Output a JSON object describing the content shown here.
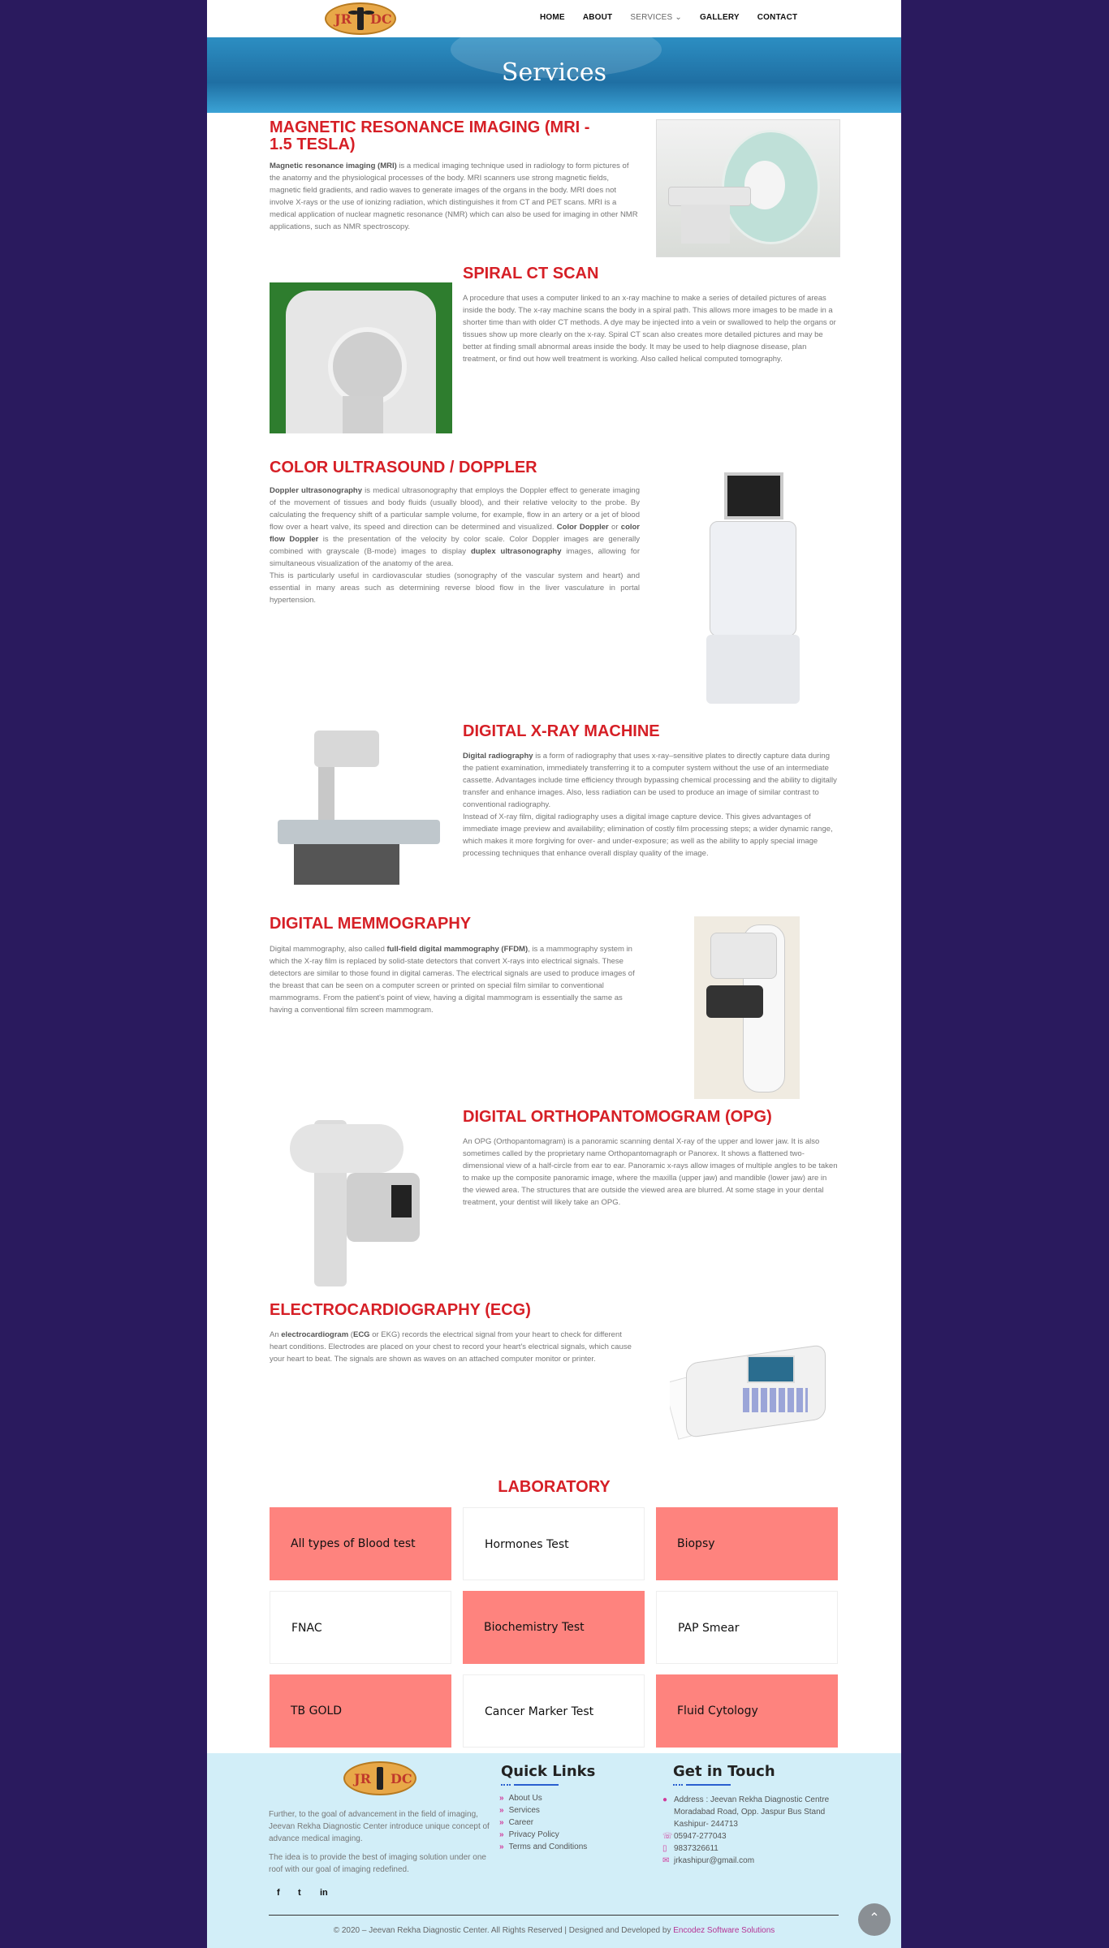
{
  "nav": {
    "logo_left": "JR",
    "logo_right": "DC",
    "items": [
      {
        "label": "HOME"
      },
      {
        "label": "ABOUT"
      },
      {
        "label": "SERVICES"
      },
      {
        "label": "GALLERY"
      },
      {
        "label": "CONTACT"
      }
    ],
    "services_chevron": "⌄"
  },
  "banner": {
    "title": "Services"
  },
  "sections": [
    {
      "title": "MAGNETIC RESONANCE IMAGING (MRI - 1.5 TESLA)",
      "lead": "Magnetic resonance imaging (MRI)",
      "text": " is a medical imaging technique used in radiology to form pictures of the anatomy and the physiological processes of the body. MRI scanners use strong magnetic fields, magnetic field gradients, and radio waves to generate images of the organs in the body. MRI does not involve X-rays or the use of ionizing radiation, which distinguishes it from CT and PET scans. MRI is a medical application of nuclear magnetic resonance (NMR) which can also be used for imaging in other NMR applications, such as NMR spectroscopy.",
      "image": "mri-scanner-image"
    },
    {
      "title": "SPIRAL CT SCAN",
      "text": "A procedure that uses a computer linked to an x-ray machine to make a series of detailed pictures of areas inside the body. The x-ray machine scans the body in a spiral path. This allows more images to be made in a shorter time than with older CT methods. A dye may be injected into a vein or swallowed to help the organs or tissues show up more clearly on the x-ray. Spiral CT scan also creates more detailed pictures and may be better at finding small abnormal areas inside the body. It may be used to help diagnose disease, plan treatment, or find out how well treatment is working. Also called helical computed tomography.",
      "image": "ct-scanner-image"
    },
    {
      "title": "COLOR ULTRASOUND / DOPPLER",
      "text_html_parts": [
        {
          "b": "Doppler ultrasonography"
        },
        {
          "t": " is medical ultrasonography that employs the Doppler effect to generate imaging of the movement of tissues and body fluids (usually blood), and their relative velocity to the probe. By calculating the frequency shift of a particular sample volume, for example, flow in an artery or a jet of blood flow over a heart valve, its speed and direction can be determined and visualized. "
        },
        {
          "b": "Color Doppler"
        },
        {
          "t": " or "
        },
        {
          "b": "color flow Doppler"
        },
        {
          "t": " is the presentation of the velocity by color scale. Color Doppler images are generally combined with grayscale (B-mode) images to display "
        },
        {
          "b": "duplex ultrasonography"
        },
        {
          "t": " images, allowing for simultaneous visualization of the anatomy of the area."
        }
      ],
      "text2": "This is particularly useful in cardiovascular studies (sonography of the vascular system and heart) and essential in many areas such as determining reverse blood flow in the liver vasculature in portal hypertension.",
      "image": "ultrasound-machine-image"
    },
    {
      "title": "DIGITAL X-RAY MACHINE",
      "lead": "Digital radiography",
      "text": " is a form of radiography that uses x-ray–sensitive plates to directly capture data during the patient examination, immediately transferring it to a computer system without the use of an intermediate cassette. Advantages include time efficiency through bypassing chemical processing and the ability to digitally transfer and enhance images. Also, less radiation can be used to produce an image of similar contrast to conventional radiography.",
      "text2": "Instead of X-ray film, digital radiography uses a digital image capture device. This gives advantages of immediate image preview and availability; elimination of costly film processing steps; a wider dynamic range, which makes it more forgiving for over- and under-exposure; as well as the ability to apply special image processing techniques that enhance overall display quality of the image.",
      "image": "xray-machine-image"
    },
    {
      "title": "DIGITAL MEMMOGRAPHY",
      "pre": "Digital mammography, also called ",
      "lead": "full-field digital mammography (FFDM)",
      "text": ", is a mammography system in which the X-ray film is replaced by solid-state detectors that convert X-rays into electrical signals. These detectors are similar to those found in digital cameras. The electrical signals are used to produce images of the breast that can be seen on a computer screen or printed on special film similar to conventional mammograms. From the patient's point of view, having a digital mammogram is essentially the same as having a conventional film screen mammogram.",
      "image": "mammography-machine-image"
    },
    {
      "title": "DIGITAL ORTHOPANTOMOGRAM (OPG)",
      "text": "An OPG (Orthopantomagram) is a panoramic scanning dental X-ray of the upper and lower jaw. It is also sometimes called by the proprietary name Orthopantomagraph or Panorex. It shows a flattened two-dimensional view of a half-circle from ear to ear. Panoramic x-rays allow images of multiple angles to be taken to make up the composite panoramic image, where the maxilla (upper jaw) and mandible (lower jaw) are in the viewed area. The structures that are outside the viewed area are blurred. At some stage in your dental treatment, your dentist will likely take an OPG.",
      "image": "opg-machine-image"
    },
    {
      "title": "ELECTROCARDIOGRAPHY (ECG)",
      "pre": "An ",
      "lead": "electrocardiogram",
      "mid": " (",
      "lead2": "ECG",
      "text": " or EKG) records the electrical signal from your heart to check for different heart conditions. Electrodes are placed on your chest to record your heart's electrical signals, which cause your heart to beat. The signals are shown as waves on an attached computer monitor or printer.",
      "image": "ecg-machine-image"
    }
  ],
  "laboratory": {
    "title": "LABORATORY",
    "items": [
      "All types of Blood test",
      "Hormones Test",
      "Biopsy",
      "FNAC",
      "Biochemistry Test",
      "PAP Smear",
      "TB GOLD",
      "Cancer Marker Test",
      "Fluid Cytology"
    ],
    "highlight_color": "#fe837e"
  },
  "footer": {
    "about1": "Further, to the goal of advancement in the field of imaging, Jeevan Rekha Diagnostic Center introduce unique concept of advance medical imaging.",
    "about2": "The idea is to provide the best of imaging solution under one roof with our goal of imaging redefined.",
    "quick_links_title": "Quick Links",
    "quick_links": [
      "About Us",
      "Services",
      "Career",
      "Privacy Policy",
      "Terms and Conditions"
    ],
    "contact_title": "Get in Touch",
    "address": "Address : Jeevan Rekha Diagnostic Centre Moradabad Road, Opp. Jaspur Bus Stand Kashipur- 244713",
    "phone": "05947-277043",
    "mobile": "9837326611",
    "email": "jrkashipur@gmail.com",
    "social": [
      "f",
      "t",
      "in"
    ],
    "copyright": "© 2020 – Jeevan Rekha Diagnostic Center. All Rights Reserved | Designed and Developed by ",
    "developer": "Encodez Software Solutions",
    "back_to_top": "⌃"
  }
}
